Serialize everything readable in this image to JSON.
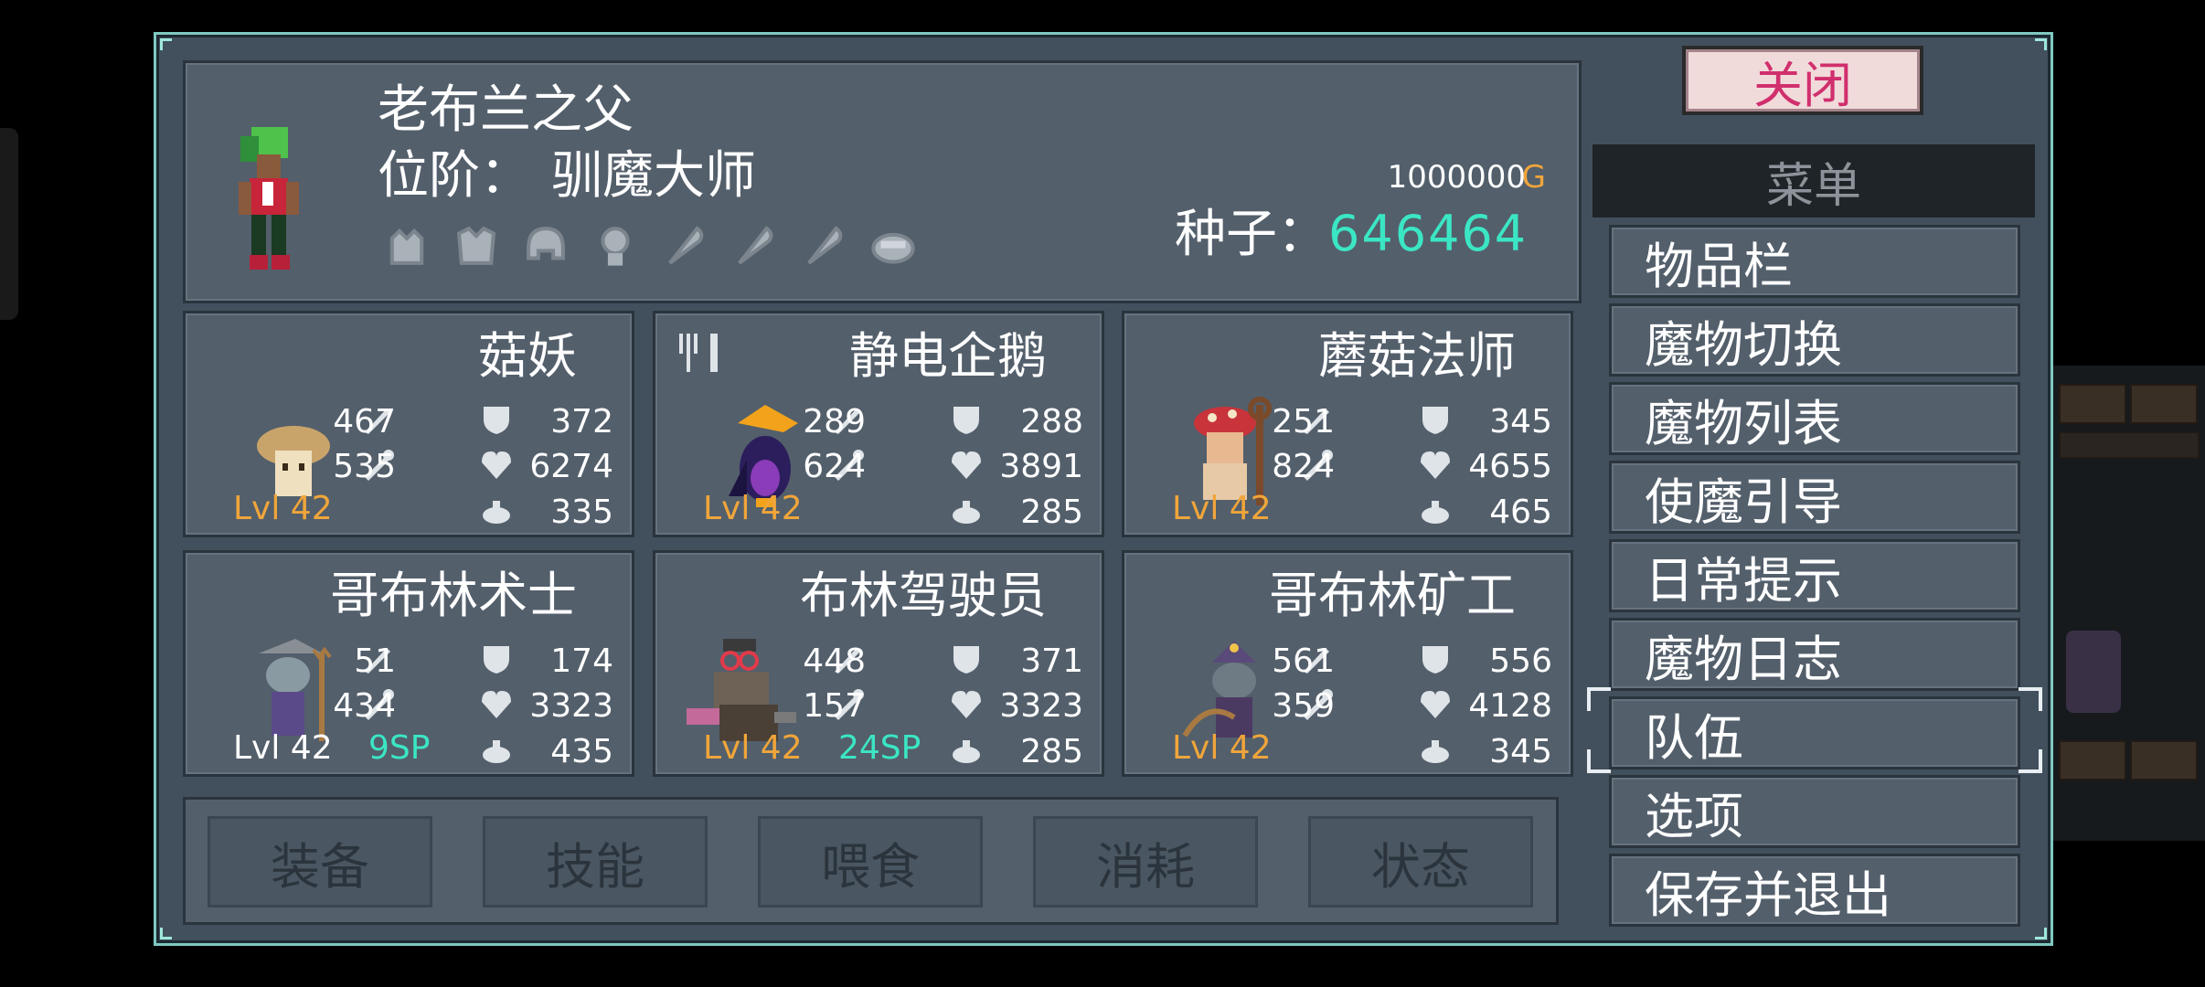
{
  "player": {
    "name": "老布兰之父",
    "rank_label": "位阶：",
    "rank_value": "驯魔大师",
    "gold": "1000000",
    "gold_unit": "G",
    "seed_label": "种子：",
    "seed_value": "646464",
    "gear_slots": [
      "gloves-icon",
      "armor-icon",
      "helmet-icon",
      "amulet-icon",
      "feather-icon",
      "feather-icon",
      "feather-icon",
      "ring-icon"
    ]
  },
  "monsters": [
    {
      "name": "菇妖",
      "atk": "467",
      "def": "372",
      "mag": "535",
      "hp": "6274",
      "food": "335",
      "level": "Lvl 42",
      "sp": ""
    },
    {
      "name": "静电企鹅",
      "atk": "289",
      "def": "288",
      "mag": "624",
      "hp": "3891",
      "food": "285",
      "level": "Lvl 42",
      "sp": ""
    },
    {
      "name": "蘑菇法师",
      "atk": "251",
      "def": "345",
      "mag": "824",
      "hp": "4655",
      "food": "465",
      "level": "Lvl 42",
      "sp": ""
    },
    {
      "name": "哥布林术士",
      "atk": "51",
      "def": "174",
      "mag": "434",
      "hp": "3323",
      "food": "435",
      "level": "Lvl 42",
      "sp": "9SP"
    },
    {
      "name": "布林驾驶员",
      "atk": "448",
      "def": "371",
      "mag": "157",
      "hp": "3323",
      "food": "285",
      "level": "Lvl 42",
      "sp": "24SP"
    },
    {
      "name": "哥布林矿工",
      "atk": "561",
      "def": "556",
      "mag": "359",
      "hp": "4128",
      "food": "345",
      "level": "Lvl 42",
      "sp": ""
    }
  ],
  "actions": [
    "装备",
    "技能",
    "喂食",
    "消耗",
    "状态"
  ],
  "menu": {
    "close": "关闭",
    "title": "菜单",
    "items": [
      "物品栏",
      "魔物切换",
      "魔物列表",
      "使魔引导",
      "日常提示",
      "魔物日志",
      "队伍",
      "选项",
      "保存并退出"
    ],
    "selected": "队伍"
  },
  "colors": {
    "panel": "#42505d",
    "border": "#7fc9c1",
    "seed": "#3be6c4",
    "level": "#f0a53a",
    "close_text": "#d02f6d"
  }
}
